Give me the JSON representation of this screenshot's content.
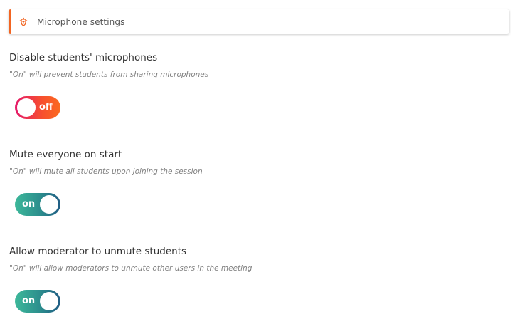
{
  "header": {
    "icon": "school-crest-icon",
    "title": "Microphone settings",
    "accent_color": "#f26522"
  },
  "settings": [
    {
      "title": "Disable students' microphones",
      "description": "\"On\" will prevent students from sharing microphones",
      "state": "off"
    },
    {
      "title": "Mute everyone on start",
      "description": "\"On\" will mute all students upon joining the session",
      "state": "on"
    },
    {
      "title": "Allow moderator to unmute students",
      "description": "\"On\" will allow moderators to unmute other users in the meeting",
      "state": "on"
    }
  ],
  "colors": {
    "toggle_off_gradient": [
      "#e4186a",
      "#fb6a1f"
    ],
    "toggle_on_gradient": [
      "#3db89a",
      "#1f5c84"
    ]
  }
}
